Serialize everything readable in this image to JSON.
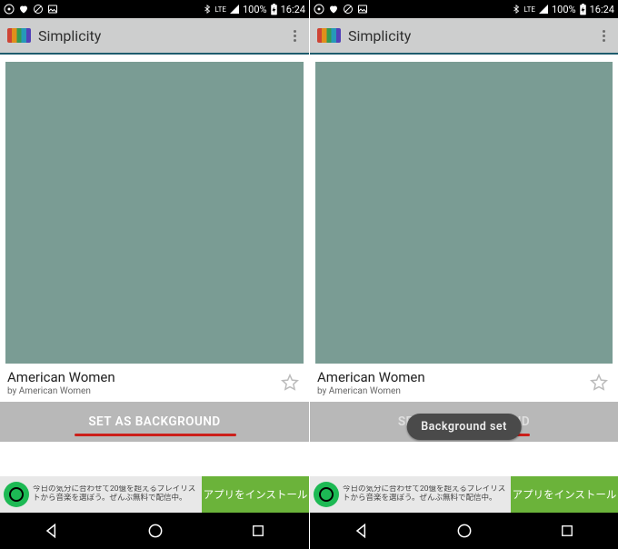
{
  "status": {
    "lte": "LTE",
    "battery": "100%",
    "time": "16:24"
  },
  "appbar": {
    "title": "Simplicity"
  },
  "card": {
    "title": "American Women",
    "byline": "by American Women"
  },
  "action": {
    "label": "SET AS BACKGROUND"
  },
  "toast": {
    "text": "Background set"
  },
  "ad": {
    "text_lines": "今日の気分に合わせて20億を超えるプレイリストから音楽を選ぼう。ぜんぶ無料で配信中。",
    "button": "アプリをインストール"
  },
  "icons": {
    "circle": "circle-dot-icon",
    "heart": "heart-icon",
    "nosign": "no-sign-icon",
    "picture": "picture-icon",
    "bt": "bluetooth-icon",
    "batt": "battery-icon",
    "more": "more-vert-icon",
    "star": "star-outline-icon",
    "back": "nav-back-icon",
    "home": "nav-home-icon",
    "recent": "nav-recent-icon"
  }
}
